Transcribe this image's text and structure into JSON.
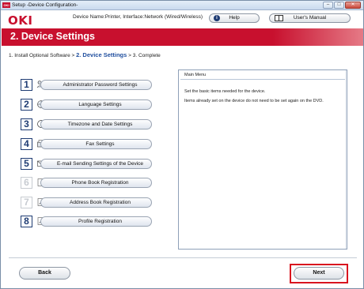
{
  "window": {
    "title": "Setup -Device Configuration-",
    "logo_text": "OKI",
    "controls": {
      "minimize": "–",
      "maximize": "□",
      "close": "✕"
    }
  },
  "header": {
    "logo": "OKI",
    "device_name": "Device Name:Printer, Interface:Network (Wired/Wireless)",
    "help_label": "Help",
    "help_icon_glyph": "i",
    "manual_label": "User's Manual"
  },
  "banner": {
    "title": "2. Device Settings",
    "color": "#c8102e"
  },
  "breadcrumb": {
    "step1": "1. Install Optional Software >",
    "step2": "2. Device Settings",
    "step3": "> 3. Complete"
  },
  "menu": {
    "items": [
      {
        "number": "1",
        "label": "Administrator Password Settings",
        "icon": "key-person-icon",
        "enabled": true
      },
      {
        "number": "2",
        "label": "Language Settings",
        "icon": "globe-icon",
        "enabled": true
      },
      {
        "number": "3",
        "label": "Timezone and Date Settings",
        "icon": "clock-icon",
        "enabled": true
      },
      {
        "number": "4",
        "label": "Fax Settings",
        "icon": "fax-icon",
        "enabled": true
      },
      {
        "number": "5",
        "label": "E-mail Sending Settings of the Device",
        "icon": "email-icon",
        "enabled": true
      },
      {
        "number": "6",
        "label": "Phone Book Registration",
        "icon": "phone-book-icon",
        "enabled": false
      },
      {
        "number": "7",
        "label": "Address Book Registration",
        "icon": "address-book-icon",
        "enabled": false
      },
      {
        "number": "8",
        "label": "Profile Registration",
        "icon": "profile-icon",
        "enabled": true
      }
    ]
  },
  "panel": {
    "title": "Main Menu",
    "line1": "Set the basic items needed for the device.",
    "line2": "Items already set on the device do not need to be set again on the DVD."
  },
  "footer": {
    "back_label": "Back",
    "next_label": "Next",
    "highlight_color": "#d9141f"
  }
}
